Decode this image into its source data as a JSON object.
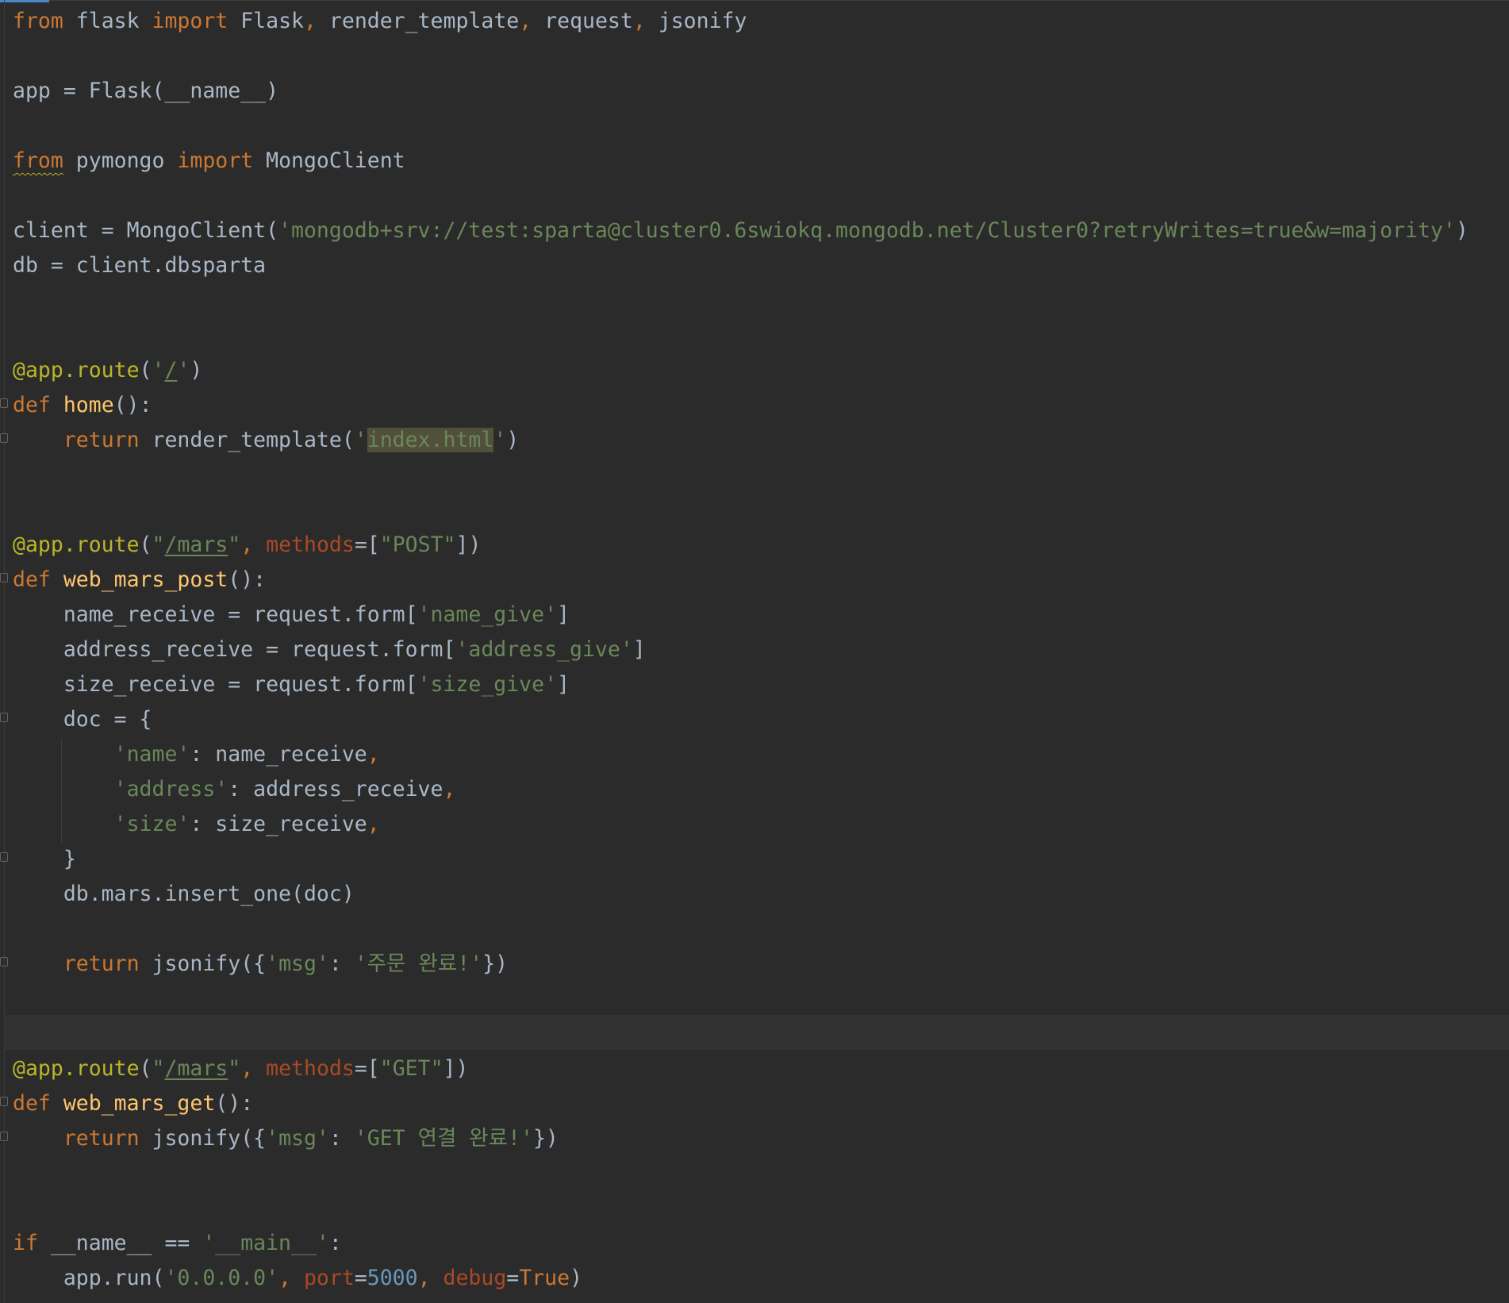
{
  "editor": {
    "language": "python",
    "lines": [
      [
        [
          "kw",
          "from "
        ],
        [
          "plain",
          "flask "
        ],
        [
          "kw",
          "import "
        ],
        [
          "plain",
          "Flask"
        ],
        [
          "kw",
          ", "
        ],
        [
          "plain",
          "render_template"
        ],
        [
          "kw",
          ", "
        ],
        [
          "plain",
          "request"
        ],
        [
          "kw",
          ", "
        ],
        [
          "plain",
          "jsonify"
        ]
      ],
      [],
      [
        [
          "plain",
          "app = Flask(__name__)"
        ]
      ],
      [],
      [
        [
          "kw warn",
          "from"
        ],
        [
          "plain",
          " pymongo "
        ],
        [
          "kw",
          "import "
        ],
        [
          "plain",
          "MongoClient"
        ]
      ],
      [],
      [
        [
          "plain",
          "client = MongoClient("
        ],
        [
          "str",
          "'mongodb+srv://test:sparta@cluster0.6swiokq.mongodb.net/Cluster0?retryWrites=true&w=majority'"
        ],
        [
          "plain",
          ")"
        ]
      ],
      [
        [
          "plain",
          "db = client.dbsparta"
        ]
      ],
      [],
      [],
      [
        [
          "deco",
          "@app.route"
        ],
        [
          "plain",
          "("
        ],
        [
          "str",
          "'"
        ],
        [
          "str uline",
          "/"
        ],
        [
          "str",
          "'"
        ],
        [
          "plain",
          ")"
        ]
      ],
      [
        [
          "kw",
          "def "
        ],
        [
          "fn",
          "home"
        ],
        [
          "plain",
          "():"
        ]
      ],
      [
        [
          "plain",
          "    "
        ],
        [
          "kw",
          "return "
        ],
        [
          "plain",
          "render_template("
        ],
        [
          "str",
          "'"
        ],
        [
          "str hl",
          "index.html"
        ],
        [
          "str",
          "'"
        ],
        [
          "plain",
          ")"
        ]
      ],
      [],
      [],
      [
        [
          "deco",
          "@app.route"
        ],
        [
          "plain",
          "("
        ],
        [
          "str",
          "\""
        ],
        [
          "str uline",
          "/mars"
        ],
        [
          "str",
          "\""
        ],
        [
          "kw",
          ", "
        ],
        [
          "param",
          "methods"
        ],
        [
          "plain",
          "=["
        ],
        [
          "str",
          "\"POST\""
        ],
        [
          "plain",
          "])"
        ]
      ],
      [
        [
          "kw",
          "def "
        ],
        [
          "fn",
          "web_mars_post"
        ],
        [
          "plain",
          "():"
        ]
      ],
      [
        [
          "plain",
          "    name_receive = request.form["
        ],
        [
          "str",
          "'name_give'"
        ],
        [
          "plain",
          "]"
        ]
      ],
      [
        [
          "plain",
          "    address_receive = request.form["
        ],
        [
          "str",
          "'address_give'"
        ],
        [
          "plain",
          "]"
        ]
      ],
      [
        [
          "plain",
          "    size_receive = request.form["
        ],
        [
          "str",
          "'size_give'"
        ],
        [
          "plain",
          "]"
        ]
      ],
      [
        [
          "plain",
          "    doc = {"
        ]
      ],
      [
        [
          "plain",
          "        "
        ],
        [
          "str",
          "'name'"
        ],
        [
          "plain",
          ": name_receive"
        ],
        [
          "kw",
          ","
        ]
      ],
      [
        [
          "plain",
          "        "
        ],
        [
          "str",
          "'address'"
        ],
        [
          "plain",
          ": address_receive"
        ],
        [
          "kw",
          ","
        ]
      ],
      [
        [
          "plain",
          "        "
        ],
        [
          "str",
          "'size'"
        ],
        [
          "plain",
          ": size_receive"
        ],
        [
          "kw",
          ","
        ]
      ],
      [
        [
          "plain",
          "    }"
        ]
      ],
      [
        [
          "plain",
          "    db.mars.insert_one(doc)"
        ]
      ],
      [],
      [
        [
          "plain",
          "    "
        ],
        [
          "kw",
          "return "
        ],
        [
          "plain",
          "jsonify({"
        ],
        [
          "str",
          "'msg'"
        ],
        [
          "plain",
          ": "
        ],
        [
          "str",
          "'주문 완료!'"
        ],
        [
          "plain",
          "})"
        ]
      ],
      [],
      [],
      [
        [
          "deco",
          "@app.route"
        ],
        [
          "plain",
          "("
        ],
        [
          "str",
          "\""
        ],
        [
          "str uline",
          "/mars"
        ],
        [
          "str",
          "\""
        ],
        [
          "kw",
          ", "
        ],
        [
          "param",
          "methods"
        ],
        [
          "plain",
          "=["
        ],
        [
          "str",
          "\"GET\""
        ],
        [
          "plain",
          "])"
        ]
      ],
      [
        [
          "kw",
          "def "
        ],
        [
          "fn",
          "web_mars_get"
        ],
        [
          "plain",
          "():"
        ]
      ],
      [
        [
          "plain",
          "    "
        ],
        [
          "kw",
          "return "
        ],
        [
          "plain",
          "jsonify({"
        ],
        [
          "str",
          "'msg'"
        ],
        [
          "plain",
          ": "
        ],
        [
          "str",
          "'GET 연결 완료!'"
        ],
        [
          "plain",
          "})"
        ]
      ],
      [],
      [],
      [
        [
          "kw",
          "if "
        ],
        [
          "plain",
          "__name__ == "
        ],
        [
          "str",
          "'__main__'"
        ],
        [
          "plain",
          ":"
        ]
      ],
      [
        [
          "plain",
          "    app.run("
        ],
        [
          "str",
          "'0.0.0.0'"
        ],
        [
          "kw",
          ", "
        ],
        [
          "param",
          "port"
        ],
        [
          "plain",
          "="
        ],
        [
          "num",
          "5000"
        ],
        [
          "kw",
          ", "
        ],
        [
          "param",
          "debug"
        ],
        [
          "plain",
          "="
        ],
        [
          "kw",
          "True"
        ],
        [
          "plain",
          ")"
        ]
      ]
    ]
  }
}
